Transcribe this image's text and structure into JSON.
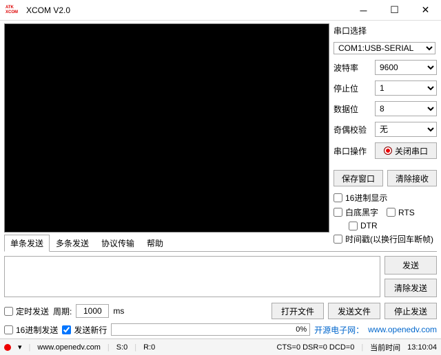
{
  "window": {
    "title": "XCOM V2.0",
    "logo1": "ATK",
    "logo2": "XCOM"
  },
  "sidebar": {
    "port_label": "串口选择",
    "port_value": "COM1:USB-SERIAL",
    "baud_label": "波特率",
    "baud_value": "9600",
    "stop_label": "停止位",
    "stop_value": "1",
    "data_label": "数据位",
    "data_value": "8",
    "parity_label": "奇偶校验",
    "parity_value": "无",
    "op_label": "串口操作",
    "op_button": "关闭串口",
    "save_btn": "保存窗口",
    "clear_btn": "清除接收",
    "hex_disp": "16进制显示",
    "white_bg": "白底黑字",
    "rts": "RTS",
    "dtr": "DTR",
    "timestamp": "时间戳(以换行回车断帧)"
  },
  "tabs": [
    "单条发送",
    "多条发送",
    "协议传输",
    "帮助"
  ],
  "send": {
    "send_btn": "发送",
    "clear_btn": "清除发送"
  },
  "row3": {
    "timed_send": "定时发送",
    "period_label": "周期:",
    "period_value": "1000",
    "ms": "ms",
    "open_file": "打开文件",
    "send_file": "发送文件",
    "stop_send": "停止发送"
  },
  "row4": {
    "hex_send": "16进制发送",
    "send_newline": "发送新行",
    "progress": "0%",
    "link_label": "开源电子网：",
    "link_url": "www.openedv.com"
  },
  "status": {
    "url": "www.openedv.com",
    "s": "S:0",
    "r": "R:0",
    "cts": "CTS=0 DSR=0 DCD=0",
    "time_label": "当前时间",
    "time": "13:10:04"
  }
}
